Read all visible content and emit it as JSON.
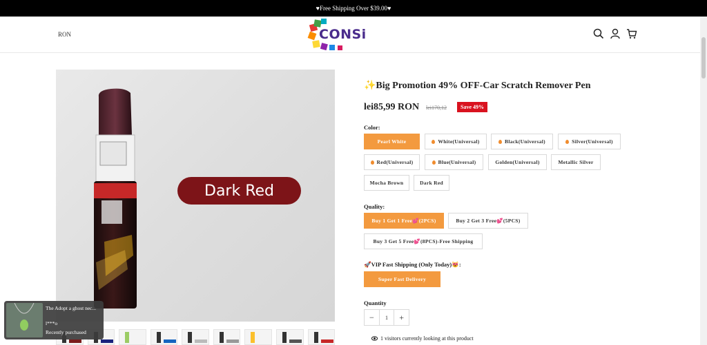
{
  "announcement": "♥Free Shipping Over $39.00♥",
  "header": {
    "currency": "RON",
    "logo_text": "CONSi"
  },
  "product": {
    "title": "✨Big Promotion 49% OFF-Car Scratch Remover Pen",
    "price": "lei85,99 RON",
    "compare_price": "lei170,12",
    "save_badge": "Save 49%",
    "image_label": "Dark Red"
  },
  "color": {
    "label": "Color:",
    "options": [
      "Pearl White",
      "White(Universal)",
      "Black(Universal)",
      "Silver(Universal)",
      "Red(Universal)",
      "Blue(Universal)",
      "Golden(Universal)",
      "Metallic Silver",
      "Mocha Brown",
      "Dark Red"
    ],
    "selected": "Pearl White"
  },
  "quality": {
    "label": "Quality:",
    "options": [
      "Buy 1 Get 1 Free💕(2PCS)",
      "Buy 2 Get 3 Free💕(5PCS)",
      "Buy 3 Get 5 Free💕(8PCS)-Free Shipping"
    ],
    "selected": "Buy 1 Get 1 Free💕(2PCS)"
  },
  "shipping": {
    "label": "🚀VIP Fast Shipping (Only Today)😻:",
    "option": "Super Fast Delivery"
  },
  "quantity": {
    "label": "Quantity",
    "value": "1",
    "minus": "−",
    "plus": "+"
  },
  "visitors_text": "1 visitors currently looking at this product",
  "toast": {
    "title": "The Adopt a ghost nec...",
    "user": "l***o",
    "subtitle": "Recently purchased"
  },
  "colors": {
    "accent": "#f39a3f",
    "save_red": "#d9121f",
    "label_red": "#7d1418"
  }
}
